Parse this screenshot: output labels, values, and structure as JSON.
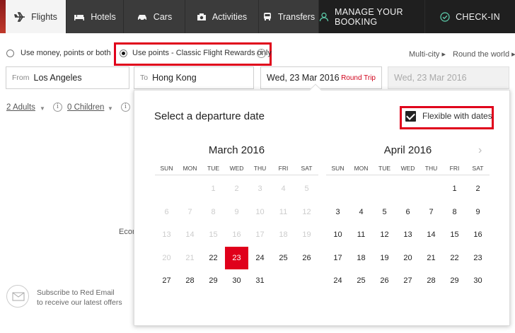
{
  "nav": {
    "tabs": [
      {
        "label": "Flights",
        "icon": "plane-icon",
        "active": true
      },
      {
        "label": "Hotels",
        "icon": "bed-icon",
        "active": false
      },
      {
        "label": "Cars",
        "icon": "car-icon",
        "active": false
      },
      {
        "label": "Activities",
        "icon": "camera-icon",
        "active": false
      },
      {
        "label": "Transfers",
        "icon": "bus-icon",
        "active": false
      },
      {
        "label": "MANAGE YOUR BOOKING",
        "icon": "person-icon",
        "active": false
      },
      {
        "label": "CHECK-IN",
        "icon": "check-circle-icon",
        "active": false
      }
    ]
  },
  "fare_options": {
    "money_label": "Use money, points or both",
    "points_label": "Use points - Classic Flight Rewards only",
    "info": "i",
    "selected": "points"
  },
  "trip_links": {
    "multicity": "Multi-city ▸",
    "roundworld": "Round the world ▸"
  },
  "search": {
    "from_label": "From",
    "from_value": "Los Angeles",
    "to_label": "To",
    "to_value": "Hong Kong",
    "depart_value": "Wed, 23 Mar 2016",
    "trip_type": "Round Trip",
    "return_value": "Wed, 23 Mar 2016"
  },
  "passengers": {
    "adults": "2 Adults",
    "children": "0 Children",
    "caret": "▼",
    "info": "i"
  },
  "econ_fragment": "Econ",
  "red_email": {
    "line1": "Subscribe to Red Email",
    "line2": "to receive our latest offers"
  },
  "calendar": {
    "title": "Select a departure date",
    "flexible_label": "Flexible with dates",
    "flexible_checked": true,
    "next_arrow": "›",
    "weekdays": [
      "SUN",
      "MON",
      "TUE",
      "WED",
      "THU",
      "FRI",
      "SAT"
    ],
    "accent": "#e0001b",
    "months": [
      {
        "name": "March 2016",
        "weeks": [
          [
            "",
            "",
            "1",
            "2",
            "3",
            "4",
            "5"
          ],
          [
            "6",
            "7",
            "8",
            "9",
            "10",
            "11",
            "12"
          ],
          [
            "13",
            "14",
            "15",
            "16",
            "17",
            "18",
            "19"
          ],
          [
            "20",
            "21",
            "22",
            "23",
            "24",
            "25",
            "26"
          ],
          [
            "27",
            "28",
            "29",
            "30",
            "31",
            "",
            ""
          ]
        ],
        "past_until": 21,
        "selected": 23
      },
      {
        "name": "April 2016",
        "weeks": [
          [
            "",
            "",
            "",
            "",
            "",
            "1",
            "2"
          ],
          [
            "3",
            "4",
            "5",
            "6",
            "7",
            "8",
            "9"
          ],
          [
            "10",
            "11",
            "12",
            "13",
            "14",
            "15",
            "16"
          ],
          [
            "17",
            "18",
            "19",
            "20",
            "21",
            "22",
            "23"
          ],
          [
            "24",
            "25",
            "26",
            "27",
            "28",
            "29",
            "30"
          ]
        ],
        "past_until": 0,
        "selected": null
      }
    ]
  }
}
